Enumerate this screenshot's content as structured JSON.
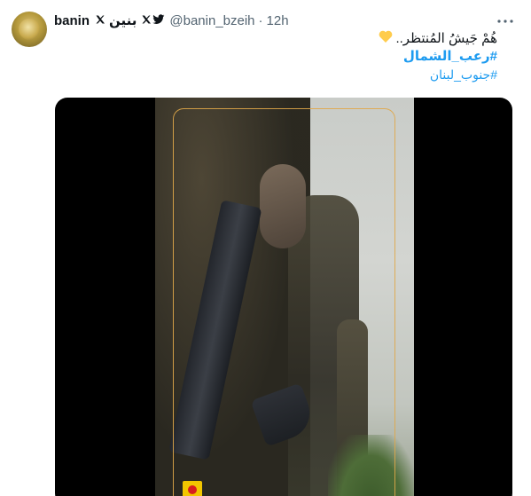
{
  "tweet": {
    "author_name": "banin",
    "author_name_ar": "بنين",
    "handle": "@banin_bzeih",
    "separator": "·",
    "time": "12h",
    "text_line": "هُمْ جَيشُ المُنتظر..",
    "heart_icon": "yellow-heart-icon",
    "hashtag_main": "#رعب_الشمال",
    "hashtag_sub": "#جنوب_لبنان",
    "more_icon": "more-options-icon"
  },
  "colors": {
    "accent": "#1d9bf0",
    "secondary_text": "#536471",
    "primary_text": "#0f1419",
    "frame": "#e0a84a",
    "heart": "#ffcc4d"
  }
}
